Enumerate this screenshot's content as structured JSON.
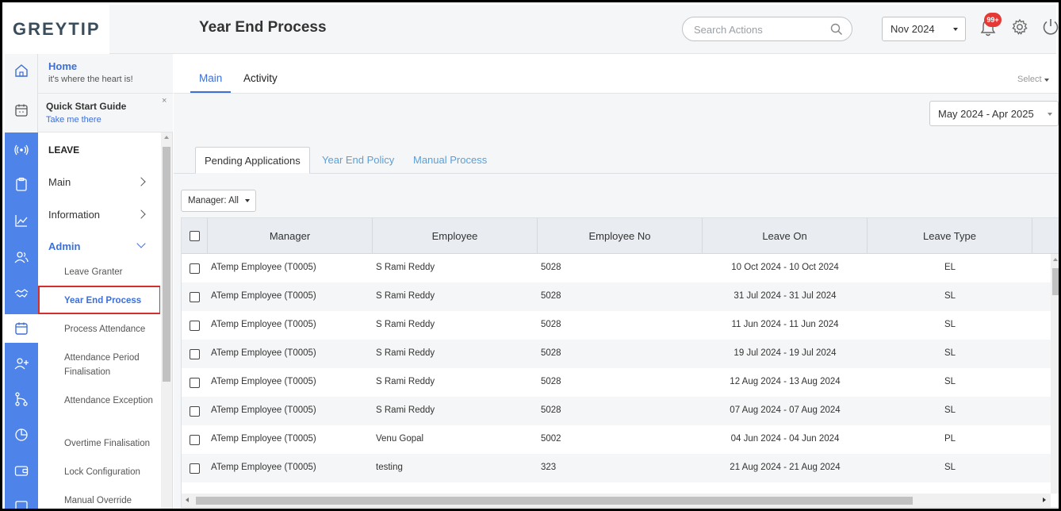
{
  "app": {
    "logo_text": "GREYTIP",
    "page_title": "Year End Process"
  },
  "header": {
    "search_placeholder": "Search Actions",
    "month_value": "Nov 2024",
    "notification_badge": "99+"
  },
  "menu": {
    "home_title": "Home",
    "home_subtitle": "it's where the heart is!",
    "quick_start_title": "Quick Start Guide",
    "quick_start_subtitle": "Take me there",
    "close_glyph": "×",
    "section_title": "LEAVE",
    "items": [
      {
        "label": "Main"
      },
      {
        "label": "Information"
      },
      {
        "label": "Admin"
      }
    ],
    "admin_items": [
      {
        "label": "Leave Granter"
      },
      {
        "label": "Year End Process"
      },
      {
        "label": "Process Attendance"
      },
      {
        "label": "Attendance Period Finalisation"
      },
      {
        "label": "Attendance Exception"
      },
      {
        "label": "Overtime Finalisation"
      },
      {
        "label": "Lock Configuration"
      },
      {
        "label": "Manual Override"
      }
    ]
  },
  "main": {
    "top_tabs": [
      {
        "label": "Main",
        "active": true
      },
      {
        "label": "Activity",
        "active": false
      }
    ],
    "select_label": "Select",
    "financial_year": "May 2024 - Apr 2025",
    "process_tabs": [
      {
        "label": "Pending Applications",
        "active": true
      },
      {
        "label": "Year End Policy",
        "active": false
      },
      {
        "label": "Manual Process",
        "active": false
      }
    ],
    "manager_filter": "Manager: All"
  },
  "table": {
    "columns": [
      "Manager",
      "Employee",
      "Employee No",
      "Leave On",
      "Leave Type"
    ],
    "rows": [
      {
        "manager": "ATemp Employee (T0005)",
        "employee": "S Rami Reddy",
        "employee_no": "5028",
        "leave_on": "10 Oct 2024 - 10 Oct 2024",
        "leave_type": "EL"
      },
      {
        "manager": "ATemp Employee (T0005)",
        "employee": "S Rami Reddy",
        "employee_no": "5028",
        "leave_on": "31 Jul 2024 - 31 Jul 2024",
        "leave_type": "SL"
      },
      {
        "manager": "ATemp Employee (T0005)",
        "employee": "S Rami Reddy",
        "employee_no": "5028",
        "leave_on": "11 Jun 2024 - 11 Jun 2024",
        "leave_type": "SL"
      },
      {
        "manager": "ATemp Employee (T0005)",
        "employee": "S Rami Reddy",
        "employee_no": "5028",
        "leave_on": "19 Jul 2024 - 19 Jul 2024",
        "leave_type": "SL"
      },
      {
        "manager": "ATemp Employee (T0005)",
        "employee": "S Rami Reddy",
        "employee_no": "5028",
        "leave_on": "12 Aug 2024 - 13 Aug 2024",
        "leave_type": "SL"
      },
      {
        "manager": "ATemp Employee (T0005)",
        "employee": "S Rami Reddy",
        "employee_no": "5028",
        "leave_on": "07 Aug 2024 - 07 Aug 2024",
        "leave_type": "SL"
      },
      {
        "manager": "ATemp Employee (T0005)",
        "employee": "Venu Gopal",
        "employee_no": "5002",
        "leave_on": "04 Jun 2024 - 04 Jun 2024",
        "leave_type": "PL"
      },
      {
        "manager": "ATemp Employee (T0005)",
        "employee": "testing",
        "employee_no": "323",
        "leave_on": "21 Aug 2024 - 21 Aug 2024",
        "leave_type": "SL"
      }
    ]
  },
  "colors": {
    "accent": "#3d6fd8",
    "rail": "#4e83ea",
    "highlight_border": "#d32f2f",
    "badge": "#e53935"
  },
  "icons": {
    "rail": [
      "home-icon",
      "calendar-clock-icon",
      "broadcast-icon",
      "clipboard-icon",
      "chart-line-icon",
      "users-icon",
      "handshake-icon",
      "calendar-icon",
      "user-add-icon",
      "git-branch-icon",
      "pie-chart-icon",
      "wallet-icon",
      "monitor-icon"
    ]
  }
}
